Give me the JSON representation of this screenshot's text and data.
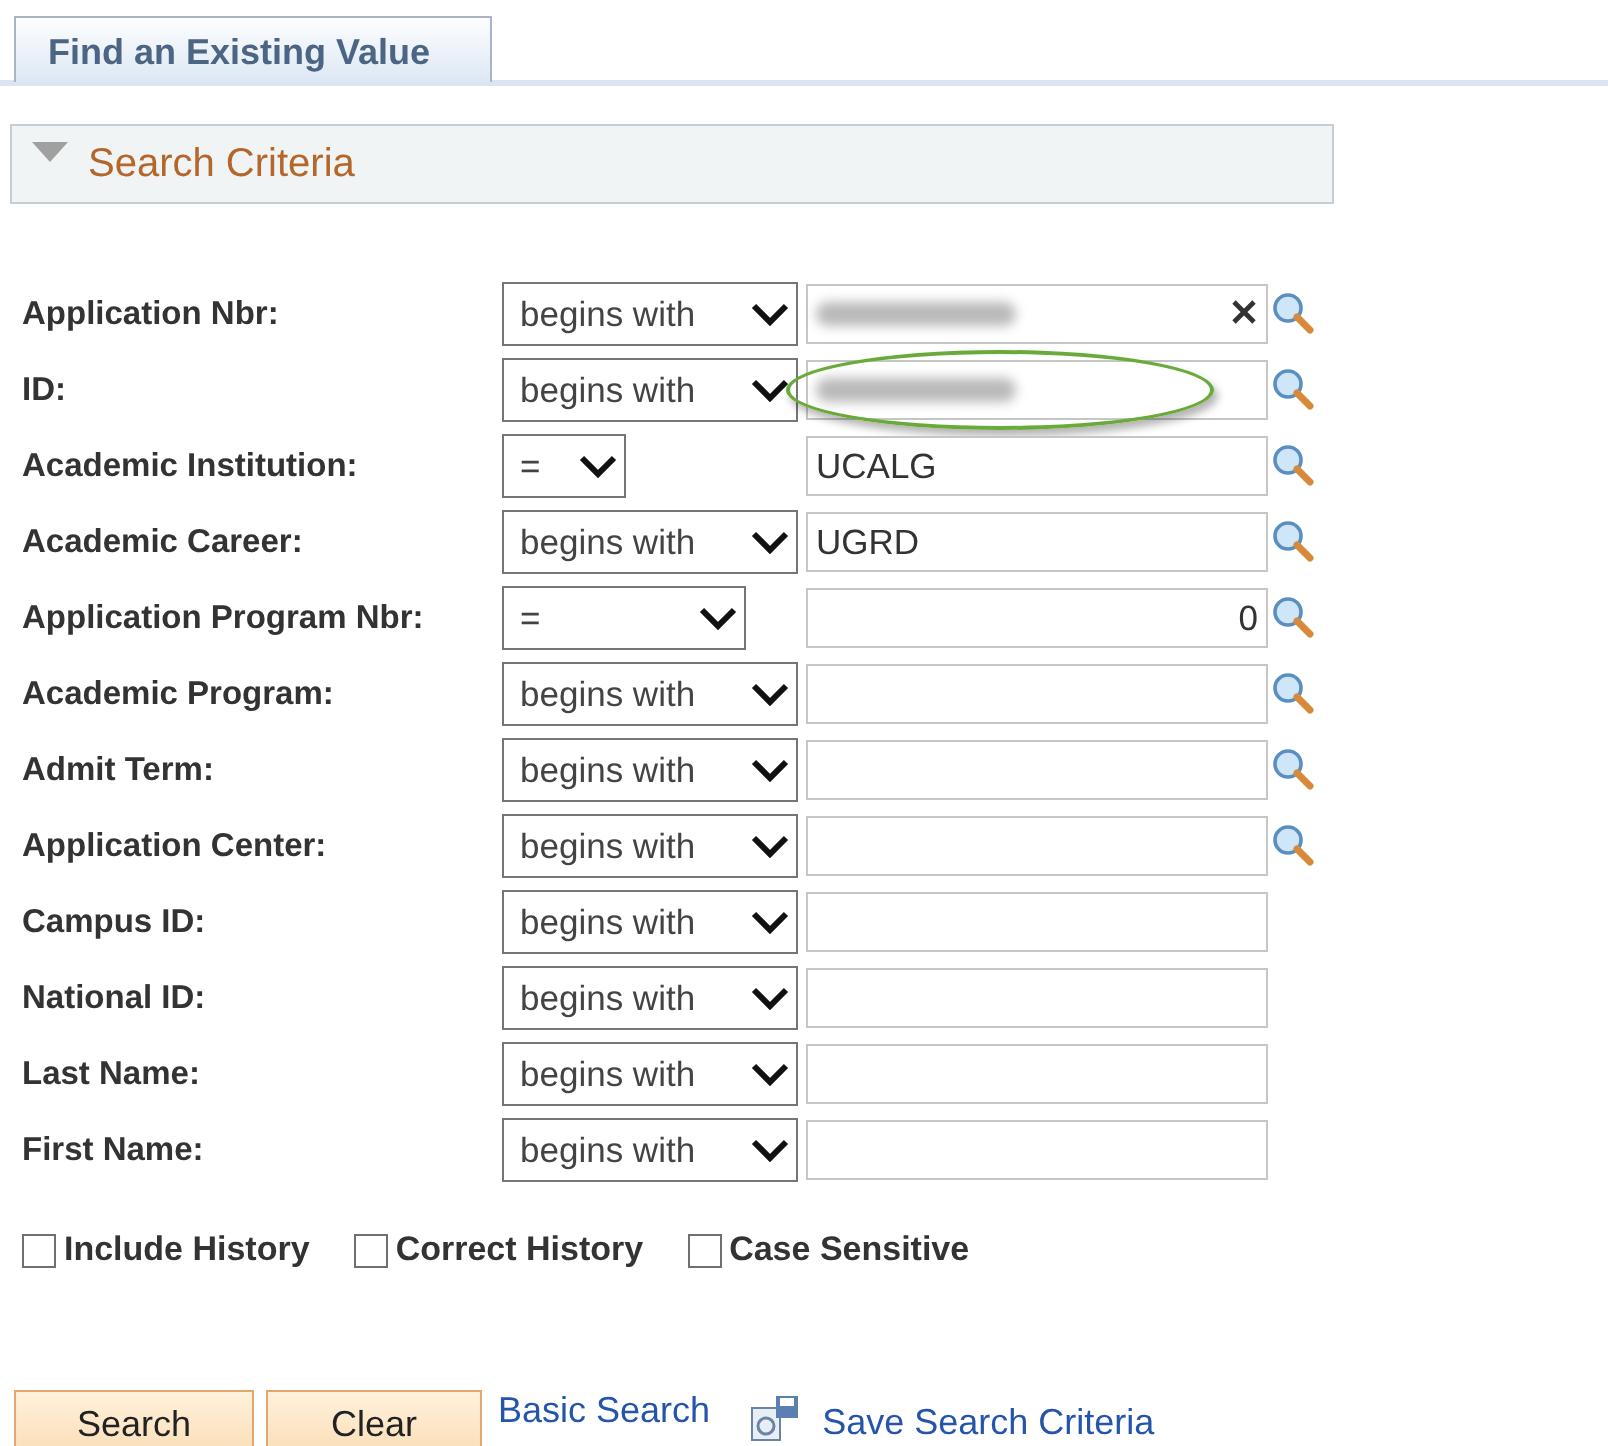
{
  "tabs": [
    {
      "label": "Find an Existing Value",
      "selected": true
    }
  ],
  "section": {
    "title": "Search Criteria",
    "expanded": true
  },
  "fields": [
    {
      "label": "Application Nbr:",
      "kind": "text",
      "operator": "begins with",
      "value_redacted": true,
      "clear": true,
      "lookup": true,
      "highlighted": false
    },
    {
      "label": "ID:",
      "kind": "text",
      "operator": "begins with",
      "value_redacted": true,
      "clear": false,
      "lookup": true,
      "highlighted": true
    },
    {
      "label": "Academic Institution:",
      "kind": "text",
      "operator": "=",
      "value": "UCALG",
      "clear": false,
      "lookup": true,
      "highlighted": false
    },
    {
      "label": "Academic Career:",
      "kind": "text",
      "operator": "begins with",
      "value": "UGRD",
      "clear": false,
      "lookup": true,
      "highlighted": false
    },
    {
      "label": "Application Program Nbr:",
      "kind": "number",
      "operator": "=",
      "value": "0",
      "clear": false,
      "lookup": true,
      "highlighted": false
    },
    {
      "label": "Academic Program:",
      "kind": "text",
      "operator": "begins with",
      "clear": false,
      "lookup": true,
      "highlighted": false
    },
    {
      "label": "Admit Term:",
      "kind": "text",
      "operator": "begins with",
      "clear": false,
      "lookup": true,
      "highlighted": false
    },
    {
      "label": "Application Center:",
      "kind": "text",
      "operator": "begins with",
      "clear": false,
      "lookup": true,
      "highlighted": false
    },
    {
      "label": "Campus ID:",
      "kind": "text",
      "operator": "begins with",
      "clear": false,
      "lookup": false,
      "highlighted": false
    },
    {
      "label": "National ID:",
      "kind": "text",
      "operator": "begins with",
      "clear": false,
      "lookup": false,
      "highlighted": false
    },
    {
      "label": "Last Name:",
      "kind": "text",
      "operator": "begins with",
      "clear": false,
      "lookup": false,
      "highlighted": false
    },
    {
      "label": "First Name:",
      "kind": "text",
      "operator": "begins with",
      "clear": false,
      "lookup": false,
      "highlighted": false
    }
  ],
  "options": [
    {
      "label": "Include History",
      "checked": false
    },
    {
      "label": "Correct History",
      "checked": false
    },
    {
      "label": "Case Sensitive",
      "checked": false
    }
  ],
  "buttons": [
    "Search",
    "Clear"
  ],
  "links": [
    {
      "label": "Basic Search",
      "icon": false
    },
    {
      "label": "Save Search Criteria",
      "icon": true
    }
  ]
}
